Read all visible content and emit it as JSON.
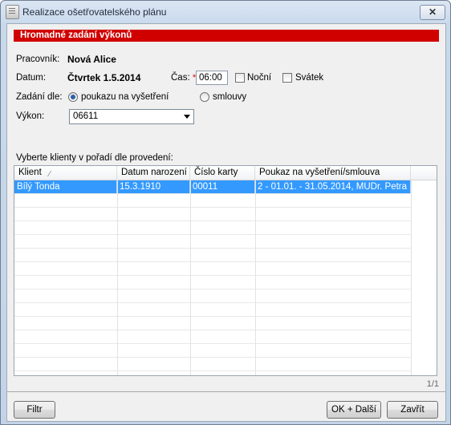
{
  "window": {
    "title": "Realizace ošetřovatelského plánu",
    "close_label": "✕"
  },
  "form": {
    "header": "Hromadné zadání výkonů",
    "worker_label": "Pracovník:",
    "worker_value": "Nová Alice",
    "date_label": "Datum:",
    "date_value": "Čtvrtek 1.5.2014",
    "time_label": "Čas:",
    "time_required_mark": "*",
    "time_value": "06:00",
    "night_label": "Noční",
    "holiday_label": "Svátek",
    "entry_by_label": "Zadání dle:",
    "radio_voucher_label": "poukazu na vyšetření",
    "radio_contract_label": "smlouvy",
    "selected_entry": "poukazu na vyšetření",
    "procedure_label": "Výkon:",
    "procedure_value": "06611"
  },
  "grid": {
    "caption": "Vyberte klienty v pořadí dle provedení:",
    "columns": [
      "Klient",
      "Datum narození",
      "Číslo karty",
      "Poukaz na vyšetření/smlouva"
    ],
    "rows": [
      [
        "Bílý Tonda",
        "15.3.1910",
        "00011",
        "2 - 01.01. - 31.05.2014, MUDr. Petra ..."
      ]
    ],
    "selected_row": 0,
    "page_info": "1/1"
  },
  "buttons": {
    "filter": "Filtr",
    "ok_next": "OK + Další",
    "close": "Zavřít"
  },
  "colors": {
    "header_bg": "#d10000",
    "selection_bg": "#3399ff"
  }
}
